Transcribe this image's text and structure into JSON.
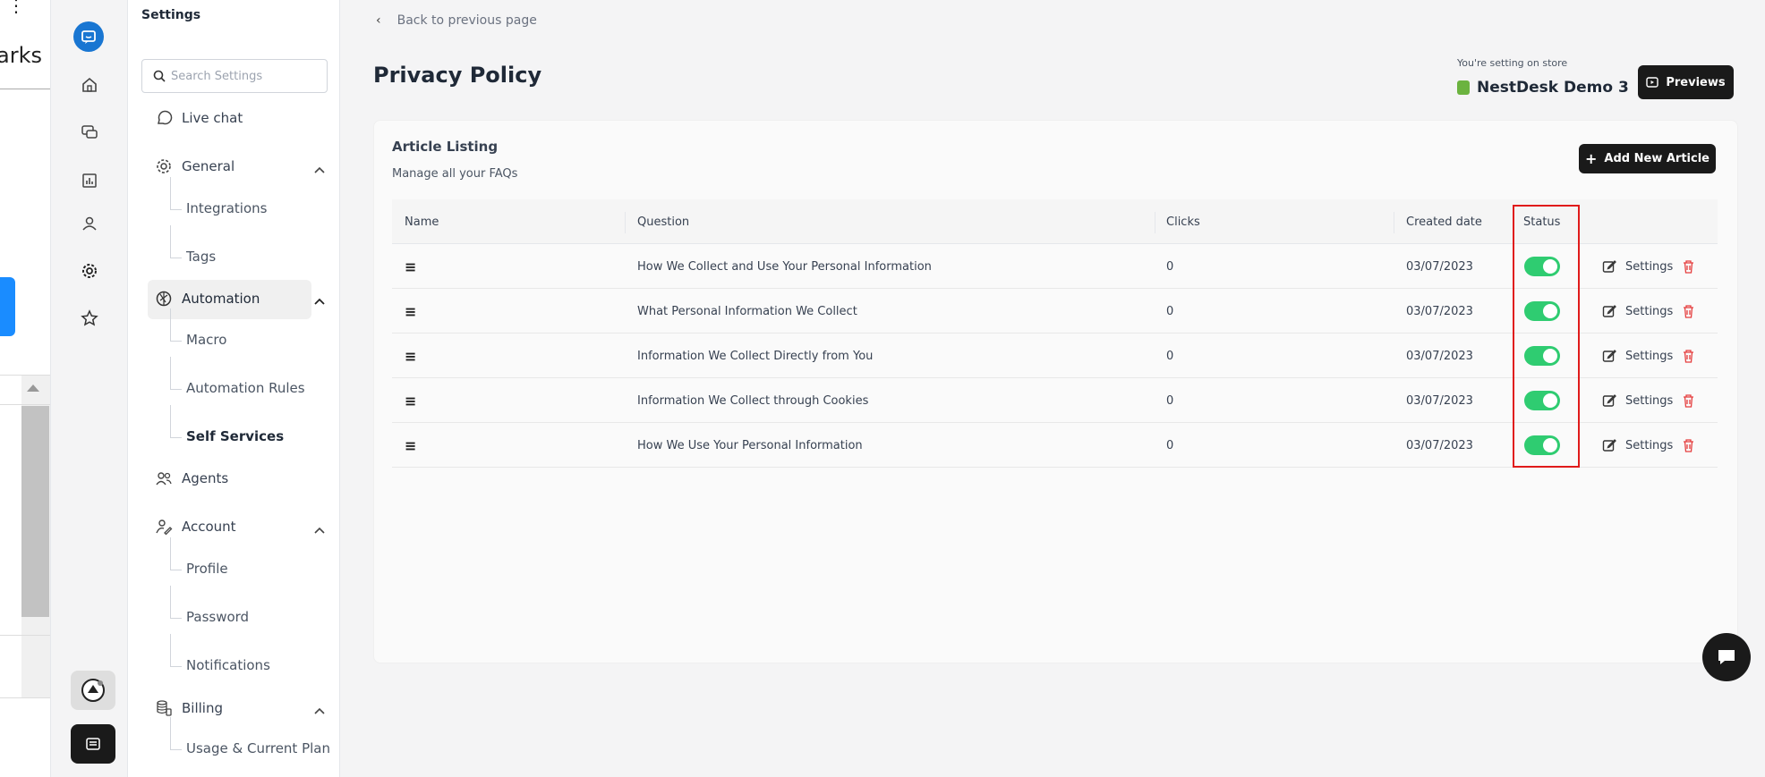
{
  "left_panel": {
    "partial_text": "arks",
    "dots": "⋮"
  },
  "sidebar": {
    "title": "Settings",
    "search_placeholder": "Search Settings",
    "items": [
      {
        "label": "Live chat",
        "icon": "chat-bubble-icon"
      },
      {
        "label": "General",
        "icon": "gear-icon",
        "subitems": [
          "Integrations",
          "Tags"
        ]
      },
      {
        "label": "Automation",
        "icon": "aperture-icon",
        "subitems": [
          "Macro",
          "Automation Rules",
          "Self Services"
        ]
      },
      {
        "label": "Agents",
        "icon": "users-icon"
      },
      {
        "label": "Account",
        "icon": "user-edit-icon",
        "subitems": [
          "Profile",
          "Password",
          "Notifications"
        ]
      },
      {
        "label": "Billing",
        "icon": "coins-icon",
        "subitems": [
          "Usage & Current Plan"
        ]
      }
    ]
  },
  "main": {
    "back_label": "Back to previous page",
    "page_title": "Privacy Policy",
    "store_label": "You're setting on store",
    "store_name": "NestDesk Demo 3",
    "previews_label": "Previews",
    "card": {
      "title": "Article Listing",
      "subtitle": "Manage all your FAQs",
      "add_label": "Add New Article",
      "columns": [
        "Name",
        "Question",
        "Clicks",
        "Created date",
        "Status"
      ],
      "action_label": "Settings",
      "rows": [
        {
          "question": "How We Collect and Use Your Personal Information",
          "clicks": "0",
          "created": "03/07/2023",
          "status_on": true
        },
        {
          "question": "What Personal Information We Collect",
          "clicks": "0",
          "created": "03/07/2023",
          "status_on": true
        },
        {
          "question": "Information We Collect Directly from You",
          "clicks": "0",
          "created": "03/07/2023",
          "status_on": true
        },
        {
          "question": "Information We Collect through Cookies",
          "clicks": "0",
          "created": "03/07/2023",
          "status_on": true
        },
        {
          "question": "How We Use Your Personal Information",
          "clicks": "0",
          "created": "03/07/2023",
          "status_on": true
        }
      ]
    }
  },
  "colors": {
    "toggle_on": "#2fcc71",
    "highlight": "#e01b1b",
    "dark_button": "#1a1a1a",
    "brand_blue": "#1976d2"
  }
}
